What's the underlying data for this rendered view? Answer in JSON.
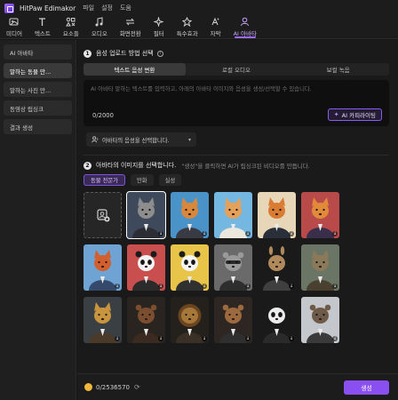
{
  "app": {
    "title": "HitPaw Edimakor",
    "menu": [
      "파일",
      "설정",
      "도움"
    ]
  },
  "toolbar": [
    {
      "label": "미디어",
      "icon": "media-icon"
    },
    {
      "label": "텍스트",
      "icon": "text-icon"
    },
    {
      "label": "요소들",
      "icon": "elements-icon"
    },
    {
      "label": "오디오",
      "icon": "audio-icon"
    },
    {
      "label": "화면전환",
      "icon": "transition-icon"
    },
    {
      "label": "필터",
      "icon": "filter-icon"
    },
    {
      "label": "특수효과",
      "icon": "effects-icon"
    },
    {
      "label": "자막",
      "icon": "subtitle-icon"
    },
    {
      "label": "AI 아바타",
      "icon": "ai-avatar-icon",
      "active": true
    }
  ],
  "sidebar": {
    "items": [
      {
        "label": "AI 아바타"
      },
      {
        "label": "말하는 동물 만...",
        "active": true
      },
      {
        "label": "말하는 사진 만..."
      },
      {
        "label": "동영상 립싱크"
      },
      {
        "label": "결과 생성"
      }
    ]
  },
  "section1": {
    "number": "1",
    "title": "음성 업로드 방법 선택",
    "tabs": [
      {
        "label": "텍스트 음성 변환",
        "active": true
      },
      {
        "label": "로컬 오디오"
      },
      {
        "label": "보컬 녹음"
      }
    ],
    "textarea": {
      "placeholder": "AI 아바타 말하는 텍스트를 입력하고, 아래의 아바타 이미지와 음성을 생성/선택할 수 있습니다.",
      "counter": "0/2000"
    },
    "copy_button": "AI 카피라이팅",
    "voice_select": "아바타의 음성을 선택합니다."
  },
  "section2": {
    "number": "2",
    "title": "아바타의 이미지를 선택합니다.",
    "hint": "\"생성\"을 클릭하면 AI가 립싱크된 비디오를 만듭니다.",
    "chips": [
      {
        "label": "동물 전문가",
        "active": true
      },
      {
        "label": "만화"
      },
      {
        "label": "실성"
      }
    ],
    "avatars": [
      {
        "name": "upload",
        "bg": "#262626"
      },
      {
        "name": "gray-cat-suit",
        "bg": "#3e4a5c",
        "fur": "#8d8d8d",
        "ear": "cat",
        "suit": "#2d2d35",
        "selected": true
      },
      {
        "name": "orange-cat-suit",
        "bg": "#4a93c9",
        "fur": "#d9873a",
        "ear": "cat",
        "suit": "#3a3a44"
      },
      {
        "name": "ginger-cat-shirt",
        "bg": "#74b7e0",
        "fur": "#e5a15a",
        "ear": "cat",
        "suit": "#ece7dc"
      },
      {
        "name": "fox-suit",
        "bg": "#e7d6b8",
        "fur": "#d97b32",
        "ear": "fox",
        "suit": "#2a2f3a"
      },
      {
        "name": "fox-red-bg",
        "bg": "#b84a4a",
        "fur": "#e08a3a",
        "ear": "fox",
        "suit": "#3a2f4a"
      },
      {
        "name": "red-fox-blazer",
        "bg": "#6fa3d4",
        "fur": "#d2602e",
        "ear": "fox",
        "suit": "#354a6b"
      },
      {
        "name": "panda-red",
        "bg": "#c94f4f",
        "fur": "#f2f2f2",
        "ear": "panda",
        "suit": "#2b2b2b"
      },
      {
        "name": "panda-yellow",
        "bg": "#e8c449",
        "fur": "#f4f4f4",
        "ear": "panda",
        "suit": "#303030"
      },
      {
        "name": "raccoon-gray",
        "bg": "#6a6a6a",
        "fur": "#9a9a9a",
        "ear": "raccoon",
        "suit": "#2e2e2e"
      },
      {
        "name": "kangaroo-suit",
        "bg": "#1a1a1a",
        "fur": "#b08a5c",
        "ear": "kangaroo",
        "suit": "#3f3f3f"
      },
      {
        "name": "cat-vintage",
        "bg": "#6a7566",
        "fur": "#8a7a5a",
        "ear": "cat",
        "suit": "#4a4030"
      },
      {
        "name": "leopard-jacket",
        "bg": "#3a3f44",
        "fur": "#c8953e",
        "ear": "cat",
        "suit": "#4a3a2a"
      },
      {
        "name": "bear-brown",
        "bg": "#2a2420",
        "fur": "#7a4e2e",
        "ear": "bear",
        "suit": "#3a2a20"
      },
      {
        "name": "lion-mane",
        "bg": "#24201c",
        "fur": "#a5783a",
        "ear": "lion",
        "suit": "#3a3026"
      },
      {
        "name": "dog-suit",
        "bg": "#2e2622",
        "fur": "#9c6a3e",
        "ear": "dog",
        "suit": "#2f2f2f"
      },
      {
        "name": "panda-dark",
        "bg": "#1a1a1a",
        "fur": "#ececec",
        "ear": "panda",
        "suit": "#2a2a2a"
      },
      {
        "name": "otter-gray",
        "bg": "#c4c8cc",
        "fur": "#6e5a48",
        "ear": "bear",
        "suit": "#3a3a3a"
      }
    ]
  },
  "footer": {
    "credits": "0/2536570",
    "generate_button": "생성"
  }
}
